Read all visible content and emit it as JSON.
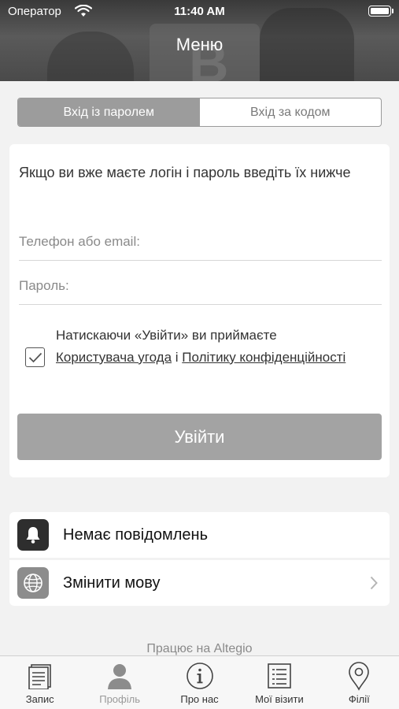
{
  "status": {
    "carrier": "Оператор",
    "time": "11:40 AM"
  },
  "header": {
    "title": "Меню"
  },
  "tabs_segment": {
    "password_login": "Вхід із паролем",
    "code_login": "Вхід за кодом",
    "active": "password_login"
  },
  "form": {
    "intro": "Якщо ви вже маєте логін і пароль введіть їх нижче",
    "phone_placeholder": "Телефон або email:",
    "password_placeholder": "Пароль:",
    "consent_checked": true,
    "consent_prefix": "Натискаючи «Увійти» ви приймаєте",
    "terms_link": "Користувача угода",
    "consent_and": "і",
    "privacy_link": "Політику конфіденційності",
    "login_button": "Увійти"
  },
  "rows": {
    "notifications": {
      "label": "Немає повідомлень",
      "icon": "bell-icon"
    },
    "language": {
      "label": "Змінити мову",
      "icon": "globe-icon"
    }
  },
  "powered_by": "Працює на Altegio",
  "tabbar": {
    "items": [
      {
        "label": "Запис",
        "icon": "booking-icon",
        "active": false
      },
      {
        "label": "Профіль",
        "icon": "profile-icon",
        "active": false,
        "dim": true
      },
      {
        "label": "Про нас",
        "icon": "info-icon",
        "active": false
      },
      {
        "label": "Мої візити",
        "icon": "list-icon",
        "active": false
      },
      {
        "label": "Філії",
        "icon": "location-pin-icon",
        "active": false
      }
    ]
  },
  "colors": {
    "header_bg": "#4a4a4a",
    "button_gray": "#a3a3a3",
    "page_bg": "#f2f2f2"
  }
}
